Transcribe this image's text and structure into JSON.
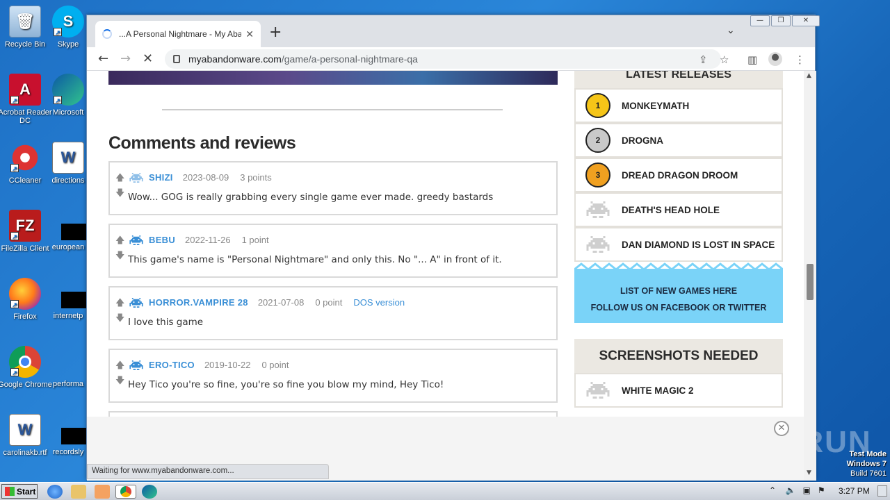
{
  "desktop": {
    "icons": [
      {
        "label": "Recycle Bin"
      },
      {
        "label": "Skype"
      },
      {
        "label": "Acrobat Reader DC"
      },
      {
        "label": "Microsoft"
      },
      {
        "label": "CCleaner"
      },
      {
        "label": "directions"
      },
      {
        "label": "FileZilla Client"
      },
      {
        "label": "european"
      },
      {
        "label": "Firefox"
      },
      {
        "label": "internetp"
      },
      {
        "label": "Google Chrome"
      },
      {
        "label": "performa"
      },
      {
        "label": "carolinakb.rtf"
      },
      {
        "label": "recordsly"
      }
    ]
  },
  "browser": {
    "tab_title": "...A Personal Nightmare - My Aband",
    "url_domain": "myabandonware.com",
    "url_path": "/game/a-personal-nightmare-qa",
    "status_text": "Waiting for www.myabandonware.com..."
  },
  "page": {
    "section_title": "Comments and reviews",
    "comments": [
      {
        "user": "SHIZI",
        "date": "2023-08-09",
        "points": "3 points",
        "version": "",
        "text": "Wow... GOG is really grabbing every single game ever made. greedy bastards"
      },
      {
        "user": "BEBU",
        "date": "2022-11-26",
        "points": "1 point",
        "version": "",
        "text": "This game's name is \"Personal Nightmare\" and only this. No \"... A\" in front of it."
      },
      {
        "user": "HORROR.VAMPIRE 28",
        "date": "2021-07-08",
        "points": "0 point",
        "version": "DOS version",
        "text": "I love this game"
      },
      {
        "user": "ERO-TICO",
        "date": "2019-10-22",
        "points": "0 point",
        "version": "",
        "text": "Hey Tico you're so fine, you're so fine you blow my mind, Hey Tico!"
      }
    ]
  },
  "sidebar": {
    "latest_title": "LATEST RELEASES",
    "latest": [
      {
        "rank": "1",
        "name": "MONKEYMATH"
      },
      {
        "rank": "2",
        "name": "DROGNA"
      },
      {
        "rank": "3",
        "name": "DREAD DRAGON DROOM"
      },
      {
        "rank": "",
        "name": "DEATH'S HEAD HOLE"
      },
      {
        "rank": "",
        "name": "DAN DIAMOND IS LOST IN SPACE"
      }
    ],
    "promo_line1": "LIST OF NEW GAMES HERE",
    "promo_line2": "FOLLOW US ON FACEBOOK OR TWITTER",
    "screenshots_title": "SCREENSHOTS NEEDED",
    "screenshots": [
      {
        "name": "WHITE MAGIC 2"
      }
    ]
  },
  "taskbar": {
    "start_label": "Start",
    "clock": "3:27 PM"
  },
  "watermark": {
    "line1": "Test Mode",
    "line2": "Windows 7",
    "line3": "Build 7601",
    "brand": "ANY RUN"
  },
  "colors": {
    "accent_blue": "#3a8fd6",
    "promo_blue": "#7ad3f8",
    "gold": "#f5c518",
    "silver": "#c9c9c9",
    "bronze": "#f0a020"
  }
}
